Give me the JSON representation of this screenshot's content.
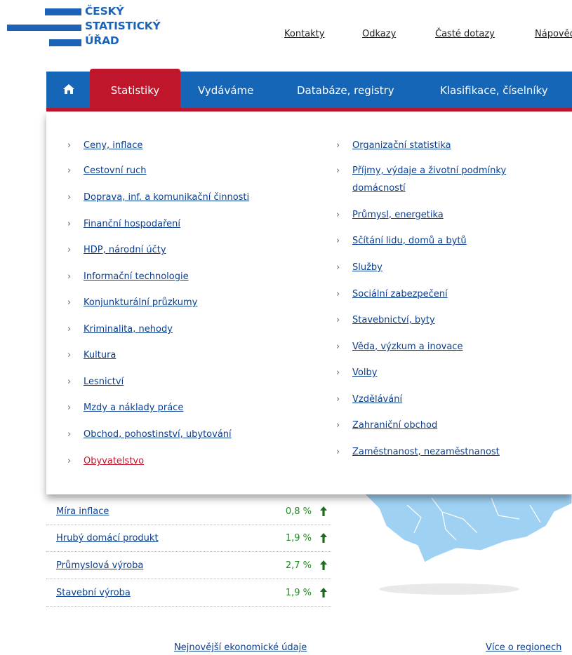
{
  "logo": {
    "line1": "ČESKÝ",
    "line2": "STATISTICKÝ",
    "line3": "ÚŘAD"
  },
  "top_links": [
    "Kontakty",
    "Odkazy",
    "Časté dotazy",
    "Nápověda"
  ],
  "nav": {
    "items": [
      "Statistiky",
      "Vydáváme",
      "Databáze, registry",
      "Klasifikace, číselníky"
    ],
    "active": "Statistiky"
  },
  "dropdown": {
    "left": [
      "Ceny, inflace",
      "Cestovní ruch",
      "Doprava, inf. a komunikační činnosti",
      "Finanční hospodaření",
      "HDP, národní účty",
      "Informační technologie",
      "Konjunkturální průzkumy",
      "Kriminalita, nehody",
      "Kultura",
      "Lesnictví",
      "Mzdy a náklady práce",
      "Obchod, pohostinství, ubytování",
      "Obyvatelstvo"
    ],
    "right": [
      "Organizační statistika",
      "Příjmy, výdaje a životní podmínky",
      "domácností",
      "Průmysl, energetika",
      "Sčítání lidu, domů a bytů",
      "Služby",
      "Sociální zabezpečení",
      "Stavebnictví, byty",
      "Věda, výzkum a inovace",
      "Volby",
      "Vzdělávání",
      "Zahraniční obchod",
      "Zaměstnanost, nezaměstnanost"
    ],
    "highlighted": "Obyvatelstvo"
  },
  "indicators": [
    {
      "name": "Míra inflace",
      "value": "0,8 %",
      "trend": "up"
    },
    {
      "name": "Hrubý domácí produkt",
      "value": "1,9 %",
      "trend": "up"
    },
    {
      "name": "Průmyslová výroba",
      "value": "2,7 %",
      "trend": "up"
    },
    {
      "name": "Stavební výroba",
      "value": "1,9 %",
      "trend": "up"
    }
  ],
  "bottom": {
    "econ_link": "Nejnovější ekonomické údaje",
    "econ_chevron": "›",
    "regions_link": "Více o regionech"
  },
  "colors": {
    "brand_blue": "#1566b6",
    "accent_red": "#c0162c",
    "link": "#0c3f8f",
    "positive": "#1a8f1a"
  },
  "icons": {
    "home": "home-icon",
    "chevron": "chevron-right-icon",
    "arrow": "arrow-up-icon"
  }
}
